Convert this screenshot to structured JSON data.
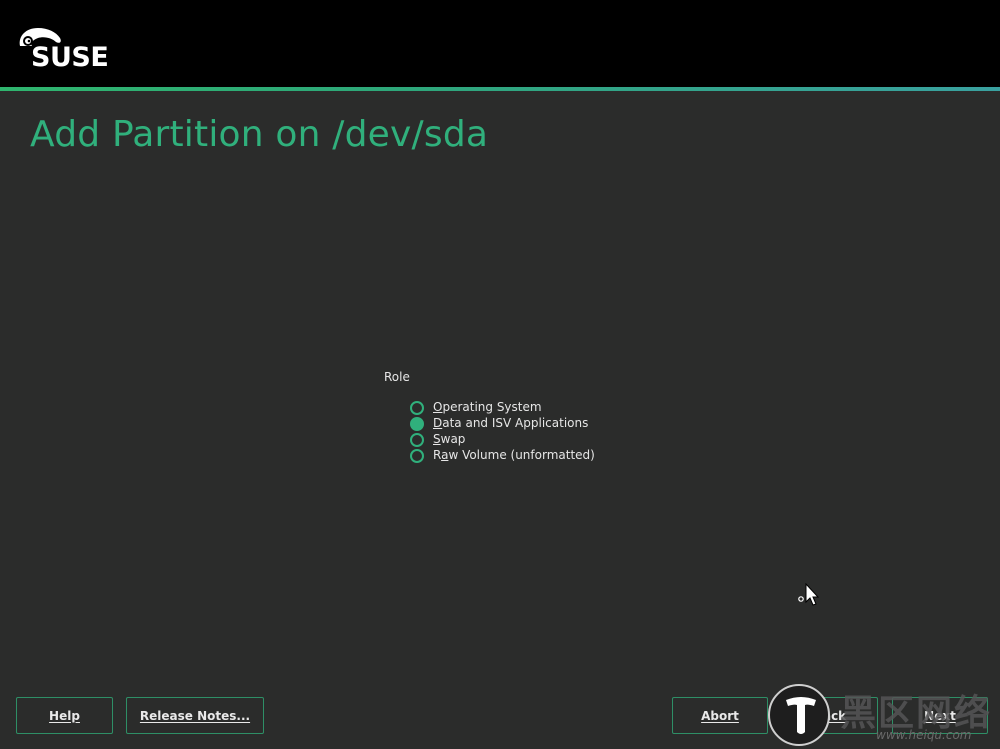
{
  "header": {
    "logo_text": "SUSE",
    "accent_color": "#30b07c"
  },
  "page": {
    "title": "Add Partition on /dev/sda"
  },
  "role": {
    "label": "Role",
    "options": [
      {
        "label": "Operating System",
        "checked": false
      },
      {
        "label": "Data and ISV Applications",
        "checked": true
      },
      {
        "label": "Swap",
        "checked": false
      },
      {
        "label": "Raw Volume (unformatted)",
        "checked": false
      }
    ]
  },
  "buttons": {
    "help": "Help",
    "release_notes": "Release Notes...",
    "abort": "Abort",
    "back": "Back",
    "next": "Next"
  },
  "watermark": {
    "chinese": "黑区网络",
    "url": "www.heiqu.com"
  }
}
